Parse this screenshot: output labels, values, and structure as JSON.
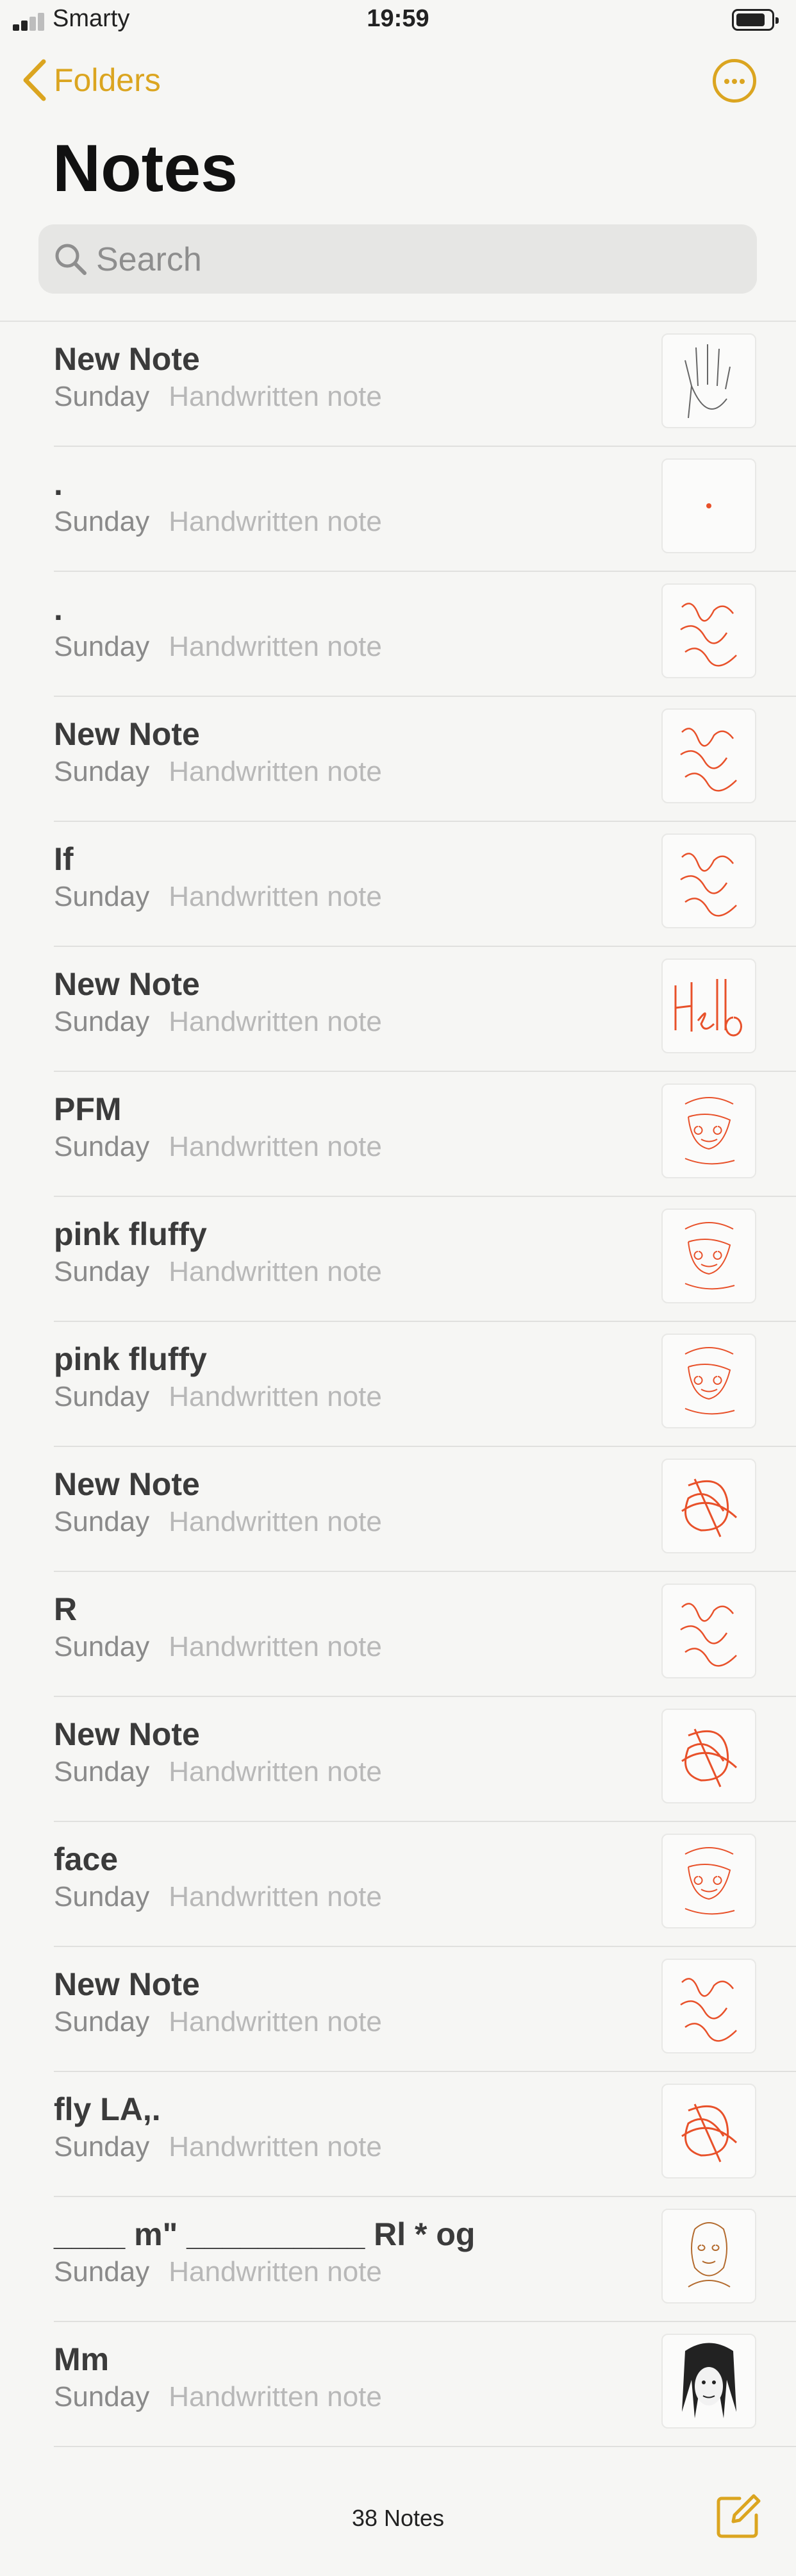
{
  "status": {
    "carrier": "Smarty",
    "time": "19:59",
    "battery_icon": "battery-icon",
    "signal_bars": 2
  },
  "nav": {
    "back_label": "Folders",
    "back_icon": "chevron-left-icon",
    "more_icon": "ellipsis-circle-icon"
  },
  "page": {
    "title": "Notes"
  },
  "search": {
    "placeholder": "Search",
    "icon": "search-icon"
  },
  "colors": {
    "accent": "#dba520",
    "ink": "#e8512a",
    "background": "#f6f6f4"
  },
  "notes": [
    {
      "title": "New Note",
      "date": "Sunday",
      "preview": "Handwritten note",
      "thumb": "hand"
    },
    {
      "title": ".",
      "date": "Sunday",
      "preview": "Handwritten note",
      "thumb": "dot"
    },
    {
      "title": ".",
      "date": "Sunday",
      "preview": "Handwritten note",
      "thumb": "scribble-text"
    },
    {
      "title": "New Note",
      "date": "Sunday",
      "preview": "Handwritten note",
      "thumb": "scribble-text"
    },
    {
      "title": "If",
      "date": "Sunday",
      "preview": "Handwritten note",
      "thumb": "scribble-text"
    },
    {
      "title": "New Note",
      "date": "Sunday",
      "preview": "Handwritten note",
      "thumb": "hello"
    },
    {
      "title": "PFM",
      "date": "Sunday",
      "preview": "Handwritten note",
      "thumb": "scribble-face"
    },
    {
      "title": "pink fluffy",
      "date": "Sunday",
      "preview": "Handwritten note",
      "thumb": "scribble-face"
    },
    {
      "title": "pink fluffy",
      "date": "Sunday",
      "preview": "Handwritten note",
      "thumb": "scribble-face"
    },
    {
      "title": "New Note",
      "date": "Sunday",
      "preview": "Handwritten note",
      "thumb": "scribble-heavy"
    },
    {
      "title": "R",
      "date": "Sunday",
      "preview": "Handwritten note",
      "thumb": "scribble-text"
    },
    {
      "title": "New Note",
      "date": "Sunday",
      "preview": "Handwritten note",
      "thumb": "scribble-heavy"
    },
    {
      "title": "face",
      "date": "Sunday",
      "preview": "Handwritten note",
      "thumb": "scribble-face"
    },
    {
      "title": "New Note",
      "date": "Sunday",
      "preview": "Handwritten note",
      "thumb": "scribble-text"
    },
    {
      "title": "fly LA,.",
      "date": "Sunday",
      "preview": "Handwritten note",
      "thumb": "scribble-heavy"
    },
    {
      "title": "____ m\" __________ Rl * og",
      "date": "Sunday",
      "preview": "Handwritten note",
      "thumb": "portrait-color"
    },
    {
      "title": "Mm",
      "date": "Sunday",
      "preview": "Handwritten note",
      "thumb": "portrait-dark"
    },
    {
      "title": "",
      "date": "",
      "preview": "",
      "thumb": "none"
    }
  ],
  "footer": {
    "count_label": "38 Notes",
    "compose_icon": "compose-icon"
  }
}
